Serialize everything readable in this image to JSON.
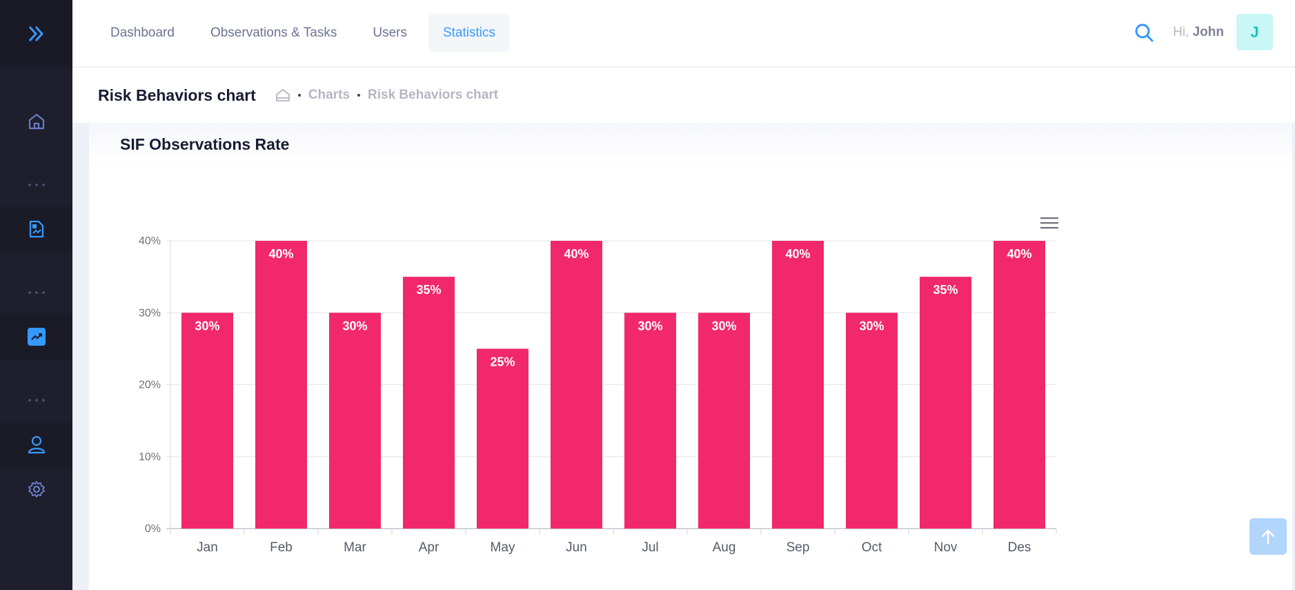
{
  "header": {
    "nav": [
      {
        "label": "Dashboard",
        "active": false
      },
      {
        "label": "Observations & Tasks",
        "active": false
      },
      {
        "label": "Users",
        "active": false
      },
      {
        "label": "Statistics",
        "active": true
      }
    ],
    "greeting": "Hi,",
    "user_name": "John",
    "avatar_letter": "J"
  },
  "subheader": {
    "title": "Risk Behaviors chart",
    "breadcrumb": [
      "Charts",
      "Risk Behaviors chart"
    ]
  },
  "card": {
    "title": "SIF Observations Rate"
  },
  "sidebar": {
    "icons": [
      "home-icon",
      "document-chart-icon",
      "trend-chart-icon",
      "user-icon",
      "gear-icon"
    ]
  },
  "colors": {
    "bar": "#f1286b",
    "accent": "#3699ff",
    "sidebar_bg": "#1e1e2d"
  },
  "chart_data": {
    "type": "bar",
    "categories": [
      "Jan",
      "Feb",
      "Mar",
      "Apr",
      "May",
      "Jun",
      "Jul",
      "Aug",
      "Sep",
      "Oct",
      "Nov",
      "Des"
    ],
    "values": [
      30,
      40,
      30,
      35,
      25,
      40,
      30,
      30,
      40,
      30,
      35,
      40
    ],
    "data_labels": [
      "30%",
      "40%",
      "30%",
      "35%",
      "25%",
      "40%",
      "30%",
      "30%",
      "40%",
      "30%",
      "35%",
      "40%"
    ],
    "yticks": [
      "0%",
      "10%",
      "20%",
      "30%",
      "40%"
    ],
    "ylim": [
      0,
      40
    ],
    "grid": true,
    "legend": false
  }
}
